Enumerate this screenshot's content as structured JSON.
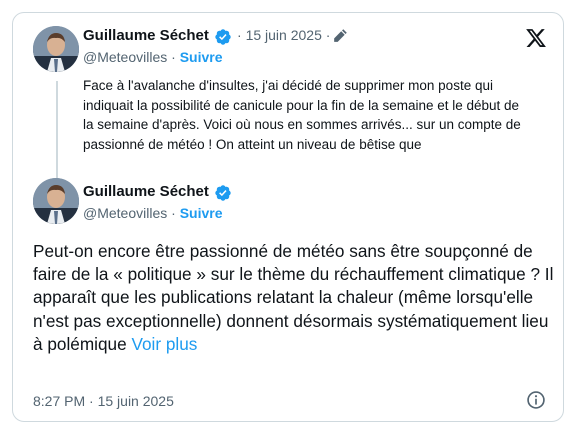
{
  "quoted_tweet": {
    "author_name": "Guillaume Séchet",
    "handle": "@Meteovilles",
    "follow_label": "Suivre",
    "date": "15 juin 2025",
    "text": "Face à l'avalanche d'insultes, j'ai décidé de supprimer mon poste qui indiquait la possibilité de canicule pour la fin de la semaine et le début de la semaine d'après. Voici où nous en sommes arrivés... sur un compte de passionné de météo ! On atteint un niveau de bêtise que"
  },
  "main_tweet": {
    "author_name": "Guillaume Séchet",
    "handle": "@Meteovilles",
    "follow_label": "Suivre",
    "text": "Peut-on encore être passionné de météo sans être soupçonné de faire de la « politique » sur le thème du réchauffement climatique ? Il apparaît que les publications relatant la chaleur (même lorsqu'elle n'est pas exceptionnelle) donnent désormais systématiquement lieu à polémique",
    "more_label": "Voir plus",
    "timestamp": "8:27 PM · 15 juin 2025"
  },
  "separators": {
    "dot": "·"
  },
  "icons": {
    "brand": "x-logo-icon",
    "verified": "verified-badge-icon",
    "edited": "edit-pencil-icon",
    "info": "info-icon"
  },
  "colors": {
    "accent": "#1d9bf0",
    "text": "#0f1419",
    "muted": "#536471",
    "border": "#cfd9de"
  }
}
